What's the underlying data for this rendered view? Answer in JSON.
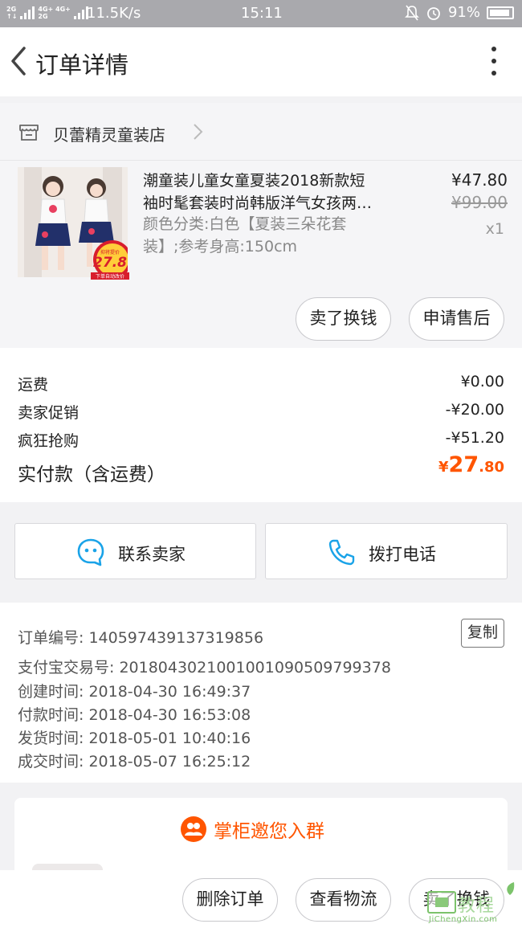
{
  "status_bar": {
    "network_top": "2G",
    "network_mid": "4G+ 4G+",
    "network_low": "2G",
    "speed": "11.5K/s",
    "time": "15:11",
    "battery": "91%"
  },
  "nav": {
    "title": "订单详情"
  },
  "store": {
    "name": "贝蕾精灵童装店"
  },
  "item": {
    "title_line1": "潮童装儿童女童夏装2018新款短",
    "title_line2": "袖时髦套装时尚韩版洋气女孩两…",
    "attrs_line1": "颜色分类:白色【夏装三朵花套",
    "attrs_line2": "装】;参考身高:150cm",
    "price": "¥47.80",
    "original_price": "¥99.00",
    "quantity": "x1",
    "thumb_badge_top": "抑将提价",
    "thumb_badge_price": "27.8",
    "thumb_badge_bottom": "下单自动改价"
  },
  "item_actions": {
    "exchange_label": "卖了换钱",
    "aftersale_label": "申请售后"
  },
  "fees": {
    "shipping_label": "运费",
    "shipping_value": "¥0.00",
    "promo_label": "卖家促销",
    "promo_value": "-¥20.00",
    "flash_label": "疯狂抢购",
    "flash_value": "-¥51.20",
    "total_label": "实付款（含运费）",
    "total_currency": "¥",
    "total_int": "27",
    "total_dec": ".80"
  },
  "contact": {
    "seller_label": "联系卖家",
    "phone_label": "拨打电话"
  },
  "order_info": {
    "order_no": "订单编号: 1405974391373198​56",
    "copy_label": "复制",
    "alipay_no": "支付宝交易号: 2018043021001001090509799378",
    "created": "创建时间: 2018-04-30 16:49:37",
    "paid": "付款时间: 2018-04-30 16:53:08",
    "shipped": "发货时间: 2018-05-01 10:40:16",
    "completed": "成交时间: 2018-05-07 16:25:12"
  },
  "invite": {
    "text": "掌柜邀您入群"
  },
  "bottom_bar": {
    "delete_label": "删除订单",
    "logistics_label": "查看物流",
    "exchange_label": "卖了换钱"
  },
  "watermark": {
    "text": "教程",
    "url": "JiChengXin.com"
  },
  "colors": {
    "accent": "#ff5500",
    "blue_icon": "#1aa3e8",
    "status_bar": "#a9a9ad"
  }
}
